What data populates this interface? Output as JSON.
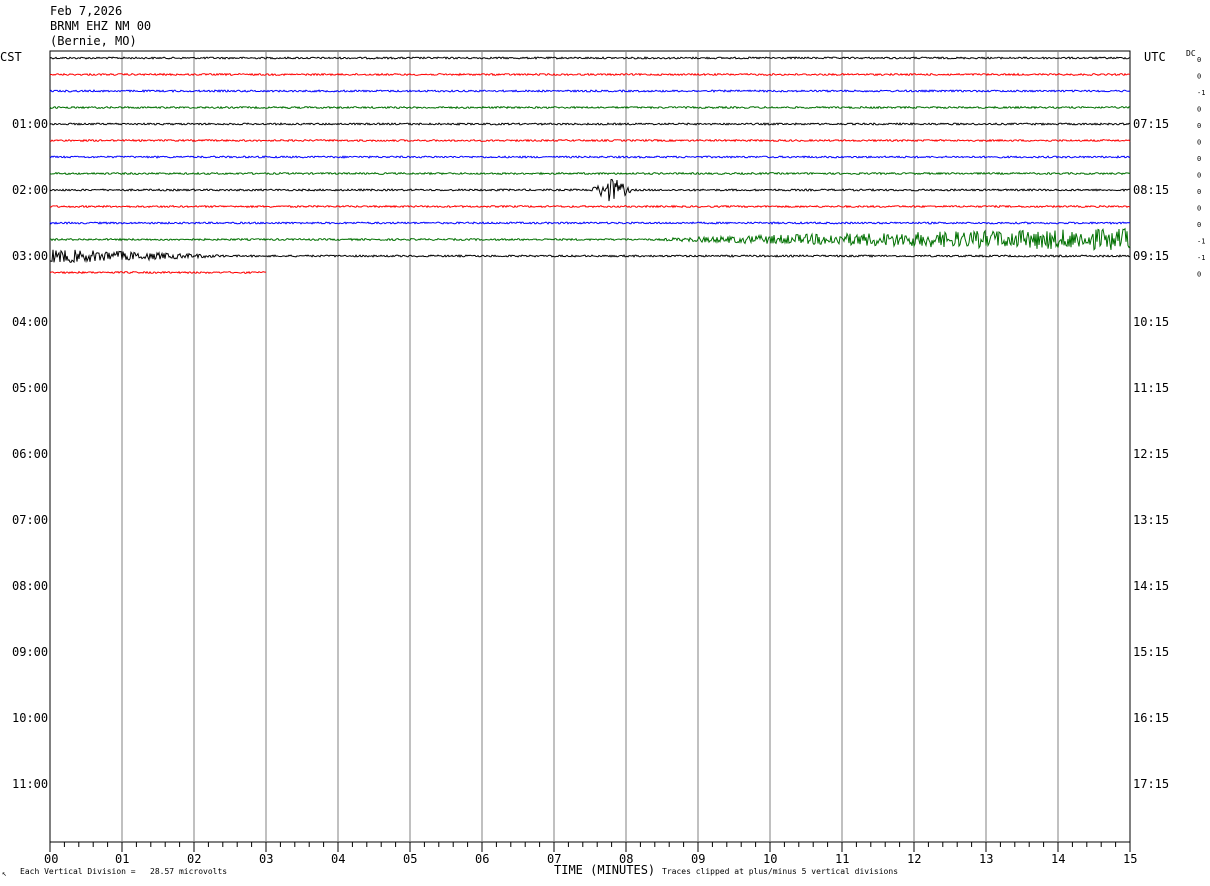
{
  "header": {
    "date": "Feb 7,2026",
    "station": "BRNM EHZ NM 00",
    "location": "(Bernie, MO)"
  },
  "axes": {
    "left_zone": "CST",
    "right_zone": "UTC",
    "dc_label": "DC",
    "xlabel": "TIME (MINUTES)"
  },
  "footer": {
    "scale_note": "Each Vertical Division =   28.57 microvolts",
    "clip_note": "Traces clipped at plus/minus 5 vertical divisions",
    "corner_mark": "↖"
  },
  "chart_data": {
    "type": "line",
    "title": "",
    "x_range": [
      0,
      15
    ],
    "x_unit": "minutes",
    "x_ticks": [
      "00",
      "01",
      "02",
      "03",
      "04",
      "05",
      "06",
      "07",
      "08",
      "09",
      "10",
      "11",
      "12",
      "13",
      "14",
      "15"
    ],
    "hour_labels_left": [
      "01:00",
      "02:00",
      "03:00",
      "04:00",
      "05:00",
      "06:00",
      "07:00",
      "08:00",
      "09:00",
      "10:00",
      "11:00"
    ],
    "hour_labels_right": [
      "07:15",
      "08:15",
      "09:15",
      "10:15",
      "11:15",
      "12:15",
      "13:15",
      "14:15",
      "15:15",
      "16:15",
      "17:15"
    ],
    "first_row_left": "CST",
    "trace_color_cycle": [
      "#000000",
      "#ff0000",
      "#0000ff",
      "#007000"
    ],
    "traces": [
      {
        "row": 0,
        "color": "#000000",
        "dc": "0",
        "end_minute": 15
      },
      {
        "row": 1,
        "color": "#ff0000",
        "dc": "0",
        "end_minute": 15
      },
      {
        "row": 2,
        "color": "#0000ff",
        "dc": "-1",
        "end_minute": 15
      },
      {
        "row": 3,
        "color": "#007000",
        "dc": "0",
        "end_minute": 15
      },
      {
        "row": 4,
        "color": "#000000",
        "dc": "0",
        "end_minute": 15
      },
      {
        "row": 5,
        "color": "#ff0000",
        "dc": "0",
        "end_minute": 15
      },
      {
        "row": 6,
        "color": "#0000ff",
        "dc": "0",
        "end_minute": 15
      },
      {
        "row": 7,
        "color": "#007000",
        "dc": "0",
        "end_minute": 15
      },
      {
        "row": 8,
        "color": "#000000",
        "dc": "0",
        "end_minute": 15,
        "event": {
          "start": 7.5,
          "end": 8.1,
          "amplitude": 1.2
        }
      },
      {
        "row": 9,
        "color": "#ff0000",
        "dc": "0",
        "end_minute": 15
      },
      {
        "row": 10,
        "color": "#0000ff",
        "dc": "0",
        "end_minute": 15
      },
      {
        "row": 11,
        "color": "#007000",
        "dc": "-1",
        "end_minute": 15,
        "noise_ramp": {
          "start": 8.5,
          "end": 15,
          "amplitude": 1.0
        }
      },
      {
        "row": 12,
        "color": "#000000",
        "dc": "-1",
        "end_minute": 15,
        "noise_decay": {
          "start": 0,
          "end": 2.5,
          "amplitude": 0.8
        }
      },
      {
        "row": 13,
        "color": "#ff0000",
        "dc": "0",
        "end_minute": 3
      }
    ]
  }
}
